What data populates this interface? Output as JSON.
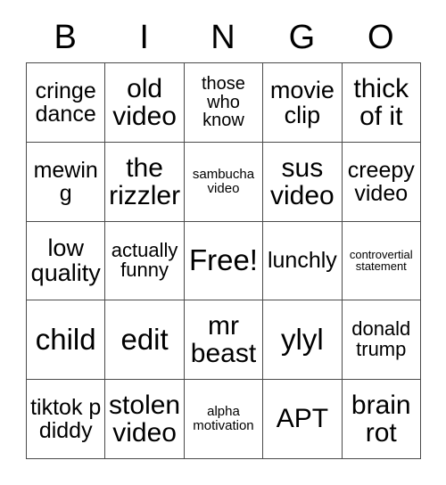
{
  "card": {
    "header_letters": [
      "B",
      "I",
      "N",
      "G",
      "O"
    ],
    "rows": [
      [
        {
          "text": "cringe dance",
          "size": "fs-xl"
        },
        {
          "text": "old video",
          "size": "fs-3xl"
        },
        {
          "text": "those who know",
          "size": "fs-md"
        },
        {
          "text": "movie clip",
          "size": "fs-2xl"
        },
        {
          "text": "thick of it",
          "size": "fs-3xl"
        }
      ],
      [
        {
          "text": "mewing",
          "size": "fs-xl"
        },
        {
          "text": "the rizzler",
          "size": "fs-3xl"
        },
        {
          "text": "sambucha video",
          "size": "fs-sm"
        },
        {
          "text": "sus video",
          "size": "fs-3xl"
        },
        {
          "text": "creepy video",
          "size": "fs-xl"
        }
      ],
      [
        {
          "text": "low quality",
          "size": "fs-2xl"
        },
        {
          "text": "actually funny",
          "size": "fs-lg"
        },
        {
          "text": "Free!",
          "size": "fs-4xl"
        },
        {
          "text": "lunchly",
          "size": "fs-xl"
        },
        {
          "text": "controvertial statement",
          "size": "fs-xs"
        }
      ],
      [
        {
          "text": "child",
          "size": "fs-4xl"
        },
        {
          "text": "edit",
          "size": "fs-4xl"
        },
        {
          "text": "mr beast",
          "size": "fs-3xl"
        },
        {
          "text": "ylyl",
          "size": "fs-4xl"
        },
        {
          "text": "donald trump",
          "size": "fs-lg"
        }
      ],
      [
        {
          "text": "tiktok p diddy",
          "size": "fs-xl"
        },
        {
          "text": "stolen video",
          "size": "fs-3xl"
        },
        {
          "text": "alpha motivation",
          "size": "fs-sm"
        },
        {
          "text": "APT",
          "size": "fs-3xl"
        },
        {
          "text": "brain rot",
          "size": "fs-3xl"
        }
      ]
    ],
    "colors": {
      "background": "#ffffff",
      "border": "#4a4a4a",
      "text": "#000000"
    }
  }
}
